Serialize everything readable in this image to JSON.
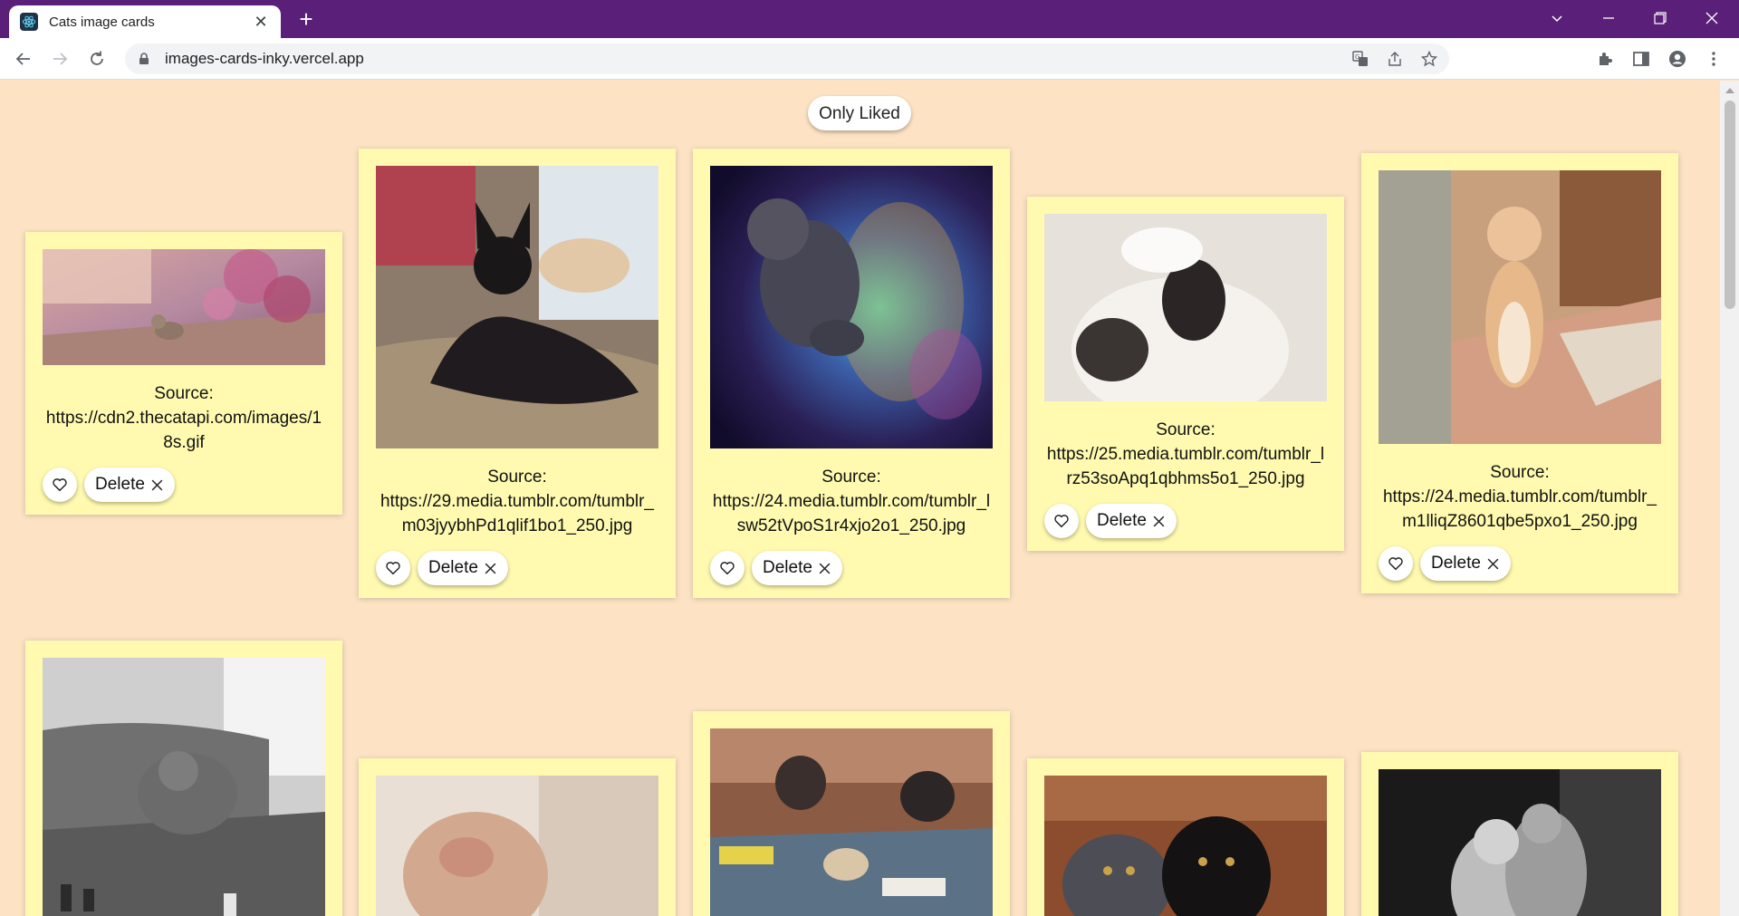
{
  "browser": {
    "tab_title": "Cats image cards",
    "url": "images-cards-inky.vercel.app",
    "new_tab": "+",
    "tab_close": "✕"
  },
  "page": {
    "only_liked_label": "Only Liked",
    "delete_label": "Delete",
    "cards": [
      {
        "source_label": "Source:",
        "source_url": "https://cdn2.thecatapi.com/images/18s.gif",
        "image": "cat-walking-flowers"
      },
      {
        "source_label": "Source:",
        "source_url": "https://29.media.tumblr.com/tumblr_m03jyybhPd1qlif1bo1_250.jpg",
        "image": "black-cat-sunbathing"
      },
      {
        "source_label": "Source:",
        "source_url": "https://24.media.tumblr.com/tumblr_lsw52tVpoS1r4xjo2o1_250.jpg",
        "image": "cat-in-nebula"
      },
      {
        "source_label": "Source:",
        "source_url": "https://25.media.tumblr.com/tumblr_lrz53soApq1qbhms5o1_250.jpg",
        "image": "cat-looking-up"
      },
      {
        "source_label": "Source:",
        "source_url": "https://24.media.tumblr.com/tumblr_m1lliqZ8601qbe5pxo1_250.jpg",
        "image": "kitten-standing"
      },
      {
        "image": "cat-playing-chess"
      },
      {
        "image": "cat-face-closeup"
      },
      {
        "image": "cat-in-classroom"
      },
      {
        "image": "two-kittens"
      },
      {
        "image": "fluffy-cats-bw"
      }
    ]
  },
  "colors": {
    "tabbar": "#5a1f79",
    "page_bg": "#fde3c4",
    "card_bg": "#fffaaf"
  }
}
